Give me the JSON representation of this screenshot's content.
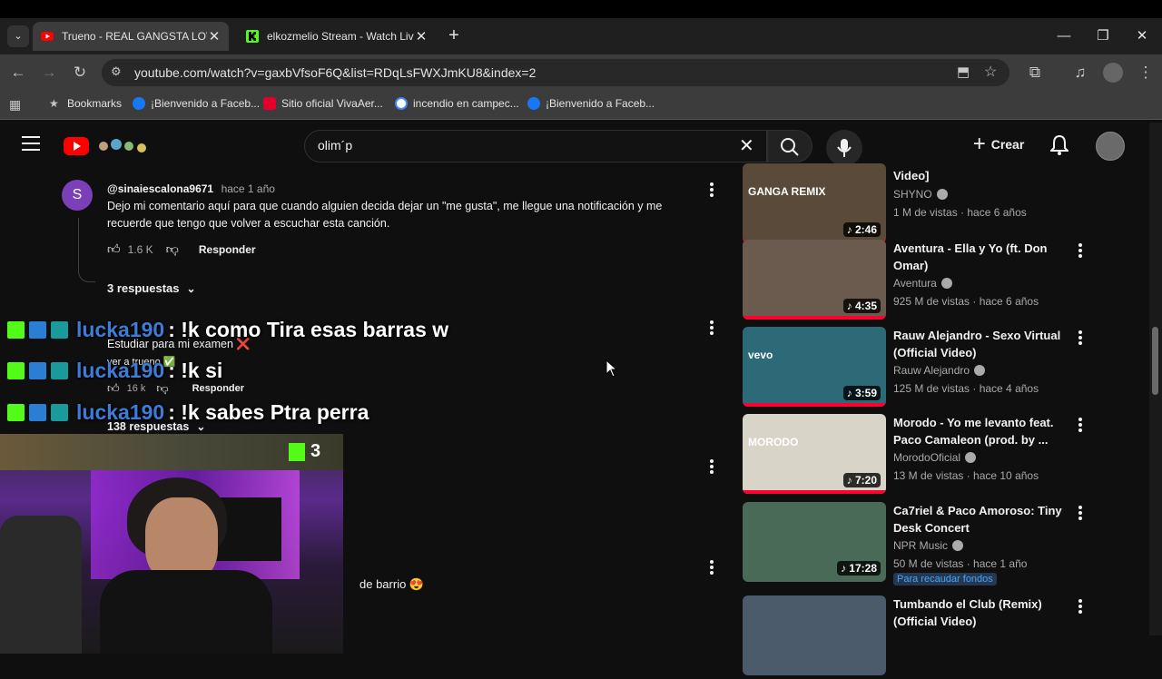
{
  "browser": {
    "tabs": [
      {
        "title": "Trueno - REAL GANGSTA LOVE",
        "active": true
      },
      {
        "title": "elkozmelio Stream - Watch Live",
        "active": false
      }
    ],
    "url": "youtube.com/watch?v=gaxbVfsoF6Q&list=RDqLsFWXJmKU8&index=2",
    "bookmarks": [
      {
        "label": "Bookmarks"
      },
      {
        "label": "¡Bienvenido a Faceb..."
      },
      {
        "label": "Sitio oficial VivaAer..."
      },
      {
        "label": "incendio en campec..."
      },
      {
        "label": "¡Bienvenido a Faceb..."
      }
    ]
  },
  "youtube": {
    "search_value": "olim´p",
    "create_label": "Crear"
  },
  "comments": [
    {
      "author": "@sinaiescalona9671",
      "age": "hace 1 año",
      "avatar_letter": "S",
      "text": "Dejo mi comentario aquí para que cuando alguien decida dejar un \"me gusta\", me llegue una notificación y me recuerde que tengo que volver a escuchar esta canción.",
      "likes": "1.6 K",
      "reply_label": "Responder",
      "replies": "3 respuestas"
    },
    {
      "text": "Estudiar para mi examen ❌",
      "text2": "ver a trueno ✅",
      "likes": "16 k",
      "reply_label": "Responder",
      "replies": "138 respuestas"
    },
    {
      "text": "de  barrio 😍"
    }
  ],
  "stream_chat": [
    {
      "user": "lucka190",
      "message": ": !k como Tira esas barras w"
    },
    {
      "user": "lucka190",
      "message": ": !k si"
    },
    {
      "user": "lucka190",
      "message": ": !k sabes Ptra perra"
    }
  ],
  "webcam": {
    "badge": "3"
  },
  "related": [
    {
      "title": "Video]",
      "channel": "SHYNO",
      "meta": "1 M de vistas · hace 6 años",
      "duration": "2:46",
      "thumb_text": "GANGA REMIX",
      "thumb_color": "#5a4a3a"
    },
    {
      "title": "Aventura - Ella y Yo (ft. Don Omar)",
      "channel": "Aventura",
      "meta": "925 M de vistas · hace 6 años",
      "duration": "4:35",
      "thumb_color": "#6b5a4e"
    },
    {
      "title": "Rauw Alejandro - Sexo Virtual (Official Video)",
      "channel": "Rauw Alejandro",
      "meta": "125 M de vistas · hace 4 años",
      "duration": "3:59",
      "thumb_text": "vevo",
      "thumb_color": "#2c6a78"
    },
    {
      "title": "Morodo - Yo me levanto feat. Paco Camaleon (prod. by ...",
      "channel": "MorodoOficial",
      "meta": "13 M de vistas · hace 10 años",
      "duration": "7:20",
      "thumb_text": "MORODO",
      "thumb_color": "#d9d4c8"
    },
    {
      "title": "Ca7riel & Paco Amoroso: Tiny Desk Concert",
      "channel": "NPR Music",
      "meta": "50 M de vistas · hace 1 año",
      "duration": "17:28",
      "badge": "Para recaudar fondos",
      "thumb_color": "#4a6a58"
    },
    {
      "title": "Tumbando el Club (Remix) (Official Video)",
      "channel": "",
      "meta": "",
      "duration": "",
      "thumb_color": "#4b5b6b"
    }
  ]
}
